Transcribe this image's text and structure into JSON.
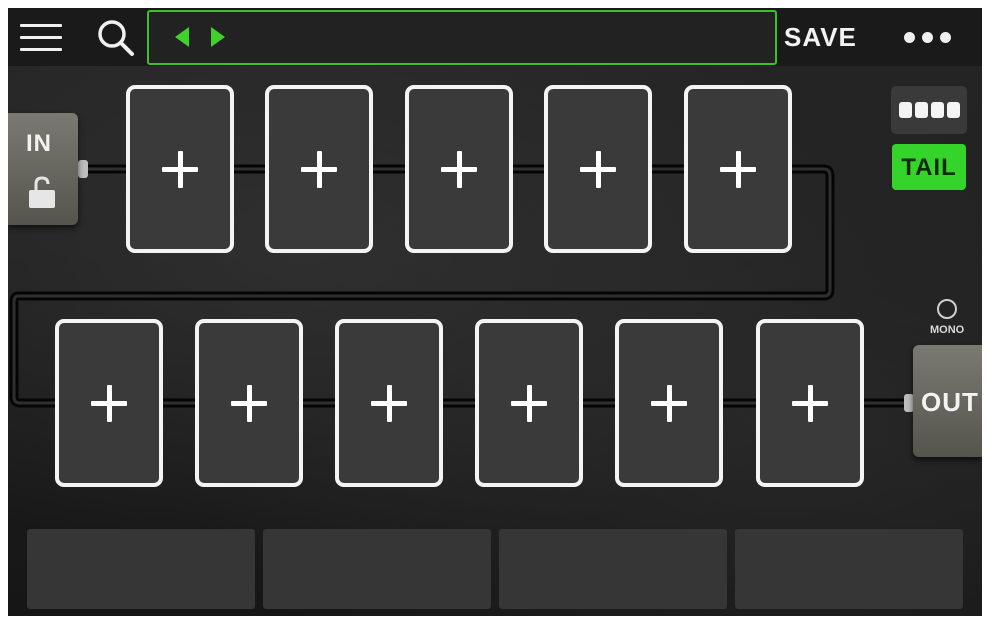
{
  "header": {
    "menu_icon": "hamburger-menu-icon",
    "search_icon": "search-icon",
    "preset_prev_icon": "triangle-left-icon",
    "preset_next_icon": "triangle-right-icon",
    "preset_name": "",
    "save_label": "SAVE",
    "more_icon": "ellipsis-icon"
  },
  "colors": {
    "accent_green": "#3fd22a",
    "block_border": "#f4f4f4",
    "tail_bg": "#34d42a"
  },
  "signal_path": {
    "input_label": "IN",
    "input_icon": "unlock-icon",
    "output_label": "OUT",
    "row1_blocks": [
      {
        "icon": "plus-icon"
      },
      {
        "icon": "plus-icon"
      },
      {
        "icon": "plus-icon"
      },
      {
        "icon": "plus-icon"
      },
      {
        "icon": "plus-icon"
      }
    ],
    "row2_blocks": [
      {
        "icon": "plus-icon"
      },
      {
        "icon": "plus-icon"
      },
      {
        "icon": "plus-icon"
      },
      {
        "icon": "plus-icon"
      },
      {
        "icon": "plus-icon"
      },
      {
        "icon": "plus-icon"
      }
    ]
  },
  "side_controls": {
    "dsp_icon": "four-segment-icon",
    "tail_label": "TAIL",
    "mono_label": "MONO"
  },
  "footswitches": [
    {
      "label": ""
    },
    {
      "label": ""
    },
    {
      "label": ""
    },
    {
      "label": ""
    }
  ]
}
